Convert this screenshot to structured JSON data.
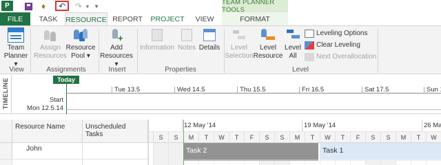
{
  "quick_access": {
    "app_badge": "P",
    "save_icon": "save-icon",
    "undo_icon": "undo-icon",
    "redo_icon": "redo-icon",
    "undo_glyph": "↶",
    "redo_glyph": "↷",
    "customize_glyph": "▾"
  },
  "contextual_header": "TEAM PLANNER TOOLS",
  "tabs": [
    {
      "label": "FILE"
    },
    {
      "label": "TASK"
    },
    {
      "label": "RESOURCE",
      "active": true
    },
    {
      "label": "REPORT"
    },
    {
      "label": "PROJECT"
    },
    {
      "label": "VIEW"
    },
    {
      "label": "FORMAT"
    }
  ],
  "ribbon": {
    "view": {
      "team_planner": "Team Planner ▾",
      "team_planner_line1": "Team",
      "team_planner_line2": "Planner ▾",
      "group_label": "View"
    },
    "assignments": {
      "assign_resources_line1": "Assign",
      "assign_resources_line2": "Resources",
      "resource_pool_line1": "Resource",
      "resource_pool_line2": "Pool ▾",
      "group_label": "Assignments"
    },
    "insert": {
      "add_resources_line1": "Add",
      "add_resources_line2": "Resources ▾",
      "group_label": "Insert"
    },
    "properties": {
      "information": "Information",
      "notes": "Notes",
      "details": "Details",
      "group_label": "Properties"
    },
    "level": {
      "level_selection_line1": "Level",
      "level_selection_line2": "Selection",
      "level_resource_line1": "Level",
      "level_resource_line2": "Resource",
      "level_all_line1": "Level",
      "level_all_line2": "All",
      "leveling_options": "Leveling Options",
      "clear_leveling": "Clear Leveling",
      "next_overallocation": "Next Overallocation",
      "group_label": "Level"
    }
  },
  "timeline": {
    "side_label": "TIMELINE",
    "today_label": "Today",
    "ticks": [
      "Tue 13.5",
      "Wed 14.5",
      "Thu 15.5",
      "Fri 16.5",
      "Sat 17.5",
      "Sun 1"
    ],
    "start_label": "Start",
    "start_date": "Mon 12.5.14"
  },
  "grid": {
    "columns": {
      "resource_name": "Resource Name",
      "unscheduled": "Unscheduled Tasks"
    },
    "rows": [
      {
        "resource": "John",
        "unscheduled": ""
      }
    ]
  },
  "gantt": {
    "weeks": [
      "12 May '14",
      "19 May '14",
      "26 May"
    ],
    "days": [
      "S",
      "S",
      "M",
      "T",
      "W",
      "T",
      "F",
      "S",
      "S",
      "M",
      "T",
      "W",
      "T",
      "F",
      "S",
      "S",
      "M",
      "T",
      "W"
    ],
    "weekend_indices": [
      0,
      1,
      7,
      8,
      14,
      15
    ],
    "bars": [
      {
        "label": "Task 2",
        "style": "late"
      },
      {
        "label": "Task 1",
        "style": "scheduled"
      }
    ]
  }
}
